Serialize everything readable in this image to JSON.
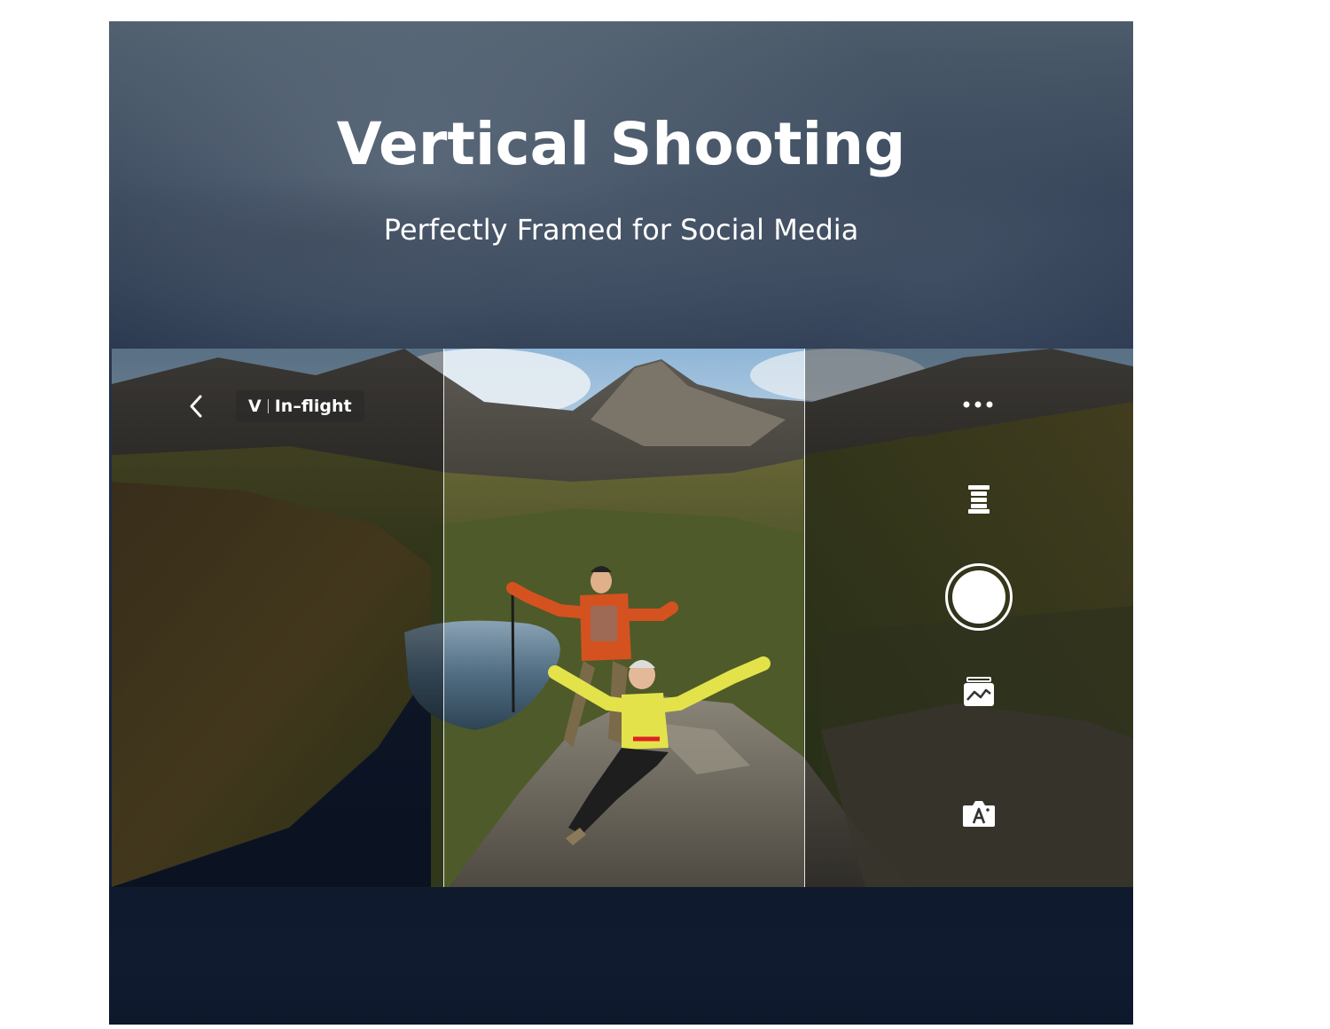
{
  "header": {
    "title": "Vertical Shooting",
    "subtitle": "Perfectly Framed for Social Media"
  },
  "camera_ui": {
    "mode_prefix": "V",
    "mode_label": "In–flight",
    "icons": {
      "back": "chevron-left-icon",
      "more": "more-dots-icon",
      "lens": "lens-icon",
      "shutter": "shutter-icon",
      "gallery": "gallery-icon",
      "auto_mode": "auto-camera-icon"
    }
  },
  "colors": {
    "sky_top": "#4d5c6b",
    "sky_bottom": "#0f1a30",
    "ui_white": "#ffffff",
    "jacket_orange": "#d4521f",
    "jacket_yellow": "#e3e24a"
  }
}
